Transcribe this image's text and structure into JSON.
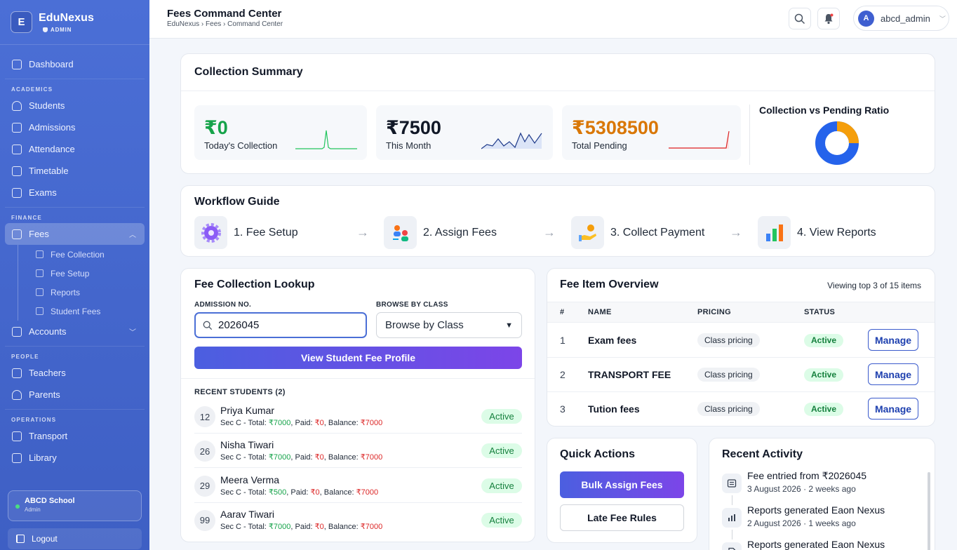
{
  "brand": {
    "logo_letter": "E",
    "name": "EduNexus",
    "badge": "ADMIN"
  },
  "sidebar": {
    "dashboard": "Dashboard",
    "sections": {
      "academics": "ACADEMICS",
      "finance": "FINANCE",
      "people": "PEOPLE",
      "operations": "OPERATIONS"
    },
    "academics": [
      "Students",
      "Admissions",
      "Attendance",
      "Timetable",
      "Exams"
    ],
    "fees": "Fees",
    "fees_sub": [
      "Fee Collection",
      "Fee Setup",
      "Reports",
      "Student Fees"
    ],
    "accounts": "Accounts",
    "people": [
      "Teachers",
      "Parents"
    ],
    "operations": [
      "Transport",
      "Library"
    ],
    "school": {
      "name": "ABCD School",
      "role": "Admin"
    },
    "logout": "Logout"
  },
  "header": {
    "title": "Fees Command Center",
    "breadcrumb": [
      "EduNexus",
      "Fees",
      "Command Center"
    ],
    "user": {
      "initial": "A",
      "name": "abcd_admin"
    }
  },
  "summary": {
    "title": "Collection Summary",
    "stats": [
      {
        "value": "₹0",
        "label": "Today's Collection",
        "color": "#16a34a"
      },
      {
        "value": "₹7500",
        "label": "This Month",
        "color": "#111827"
      },
      {
        "value": "₹5308500",
        "label": "Total Pending",
        "color": "#d97706"
      }
    ],
    "ratio_title": "Collection vs Pending Ratio",
    "ratio": {
      "collected_color": "#f59e0b",
      "pending_color": "#2563eb",
      "collected_fraction": 0.25
    }
  },
  "workflow": {
    "title": "Workflow Guide",
    "steps": [
      "1. Fee Setup",
      "2. Assign Fees",
      "3. Collect Payment",
      "4. View Reports"
    ]
  },
  "lookup": {
    "title": "Fee Collection Lookup",
    "admission_label": "ADMISSION NO.",
    "admission_value": "2026045",
    "browse_label": "BROWSE BY CLASS",
    "browse_value": "Browse by Class",
    "button": "View Student Fee Profile",
    "recent_label": "RECENT STUDENTS (2)",
    "students": [
      {
        "roll": "12",
        "name": "Priya Kumar",
        "prefix": "Sec C - Total: ",
        "total": "₹7000",
        "paid": "₹0",
        "balance": "₹7000",
        "status": "Active"
      },
      {
        "roll": "26",
        "name": "Nisha Tiwari",
        "prefix": "Sec C - Total: ",
        "total": "₹7000",
        "paid": "₹0",
        "balance": "₹7000",
        "status": "Active"
      },
      {
        "roll": "29",
        "name": "Meera Verma",
        "prefix": "Sec C - Total: ",
        "total": "₹500",
        "paid": "₹0",
        "balance": "₹7000",
        "status": "Active"
      },
      {
        "roll": "99",
        "name": "Aarav Tiwari",
        "prefix": "Sec C - Total: ",
        "total": "₹7000",
        "paid": "₹0",
        "balance": "₹7000",
        "status": "Active"
      }
    ],
    "paid_prefix": ", Paid: ",
    "balance_prefix": ", Balance: "
  },
  "fee_items": {
    "title": "Fee Item Overview",
    "viewing": "Viewing top 3 of 15 items",
    "columns": [
      "#",
      "NAME",
      "PRICING",
      "STATUS"
    ],
    "rows": [
      {
        "num": "1",
        "name": "Exam fees",
        "pricing": "Class pricing",
        "status": "Active",
        "action": "Manage"
      },
      {
        "num": "2",
        "name": "TRANSPORT FEE",
        "pricing": "Class pricing",
        "status": "Active",
        "action": "Manage"
      },
      {
        "num": "3",
        "name": "Tution fees",
        "pricing": "Class pricing",
        "status": "Active",
        "action": "Manage"
      }
    ]
  },
  "quick_actions": {
    "title": "Quick Actions",
    "primary": "Bulk Assign Fees",
    "secondary": "Late Fee Rules"
  },
  "recent_activity": {
    "title": "Recent Activity",
    "items": [
      {
        "text": "Fee entried from ₹2026045",
        "date": "3 August 2026",
        "ago": "2 weeks ago",
        "icon": "receipt-icon"
      },
      {
        "text": "Reports generated Eaon Nexus",
        "date": "2 August 2026",
        "ago": "1 weeks ago",
        "icon": "chart-icon"
      },
      {
        "text": "Reports generated Eaon Nexus",
        "date": "",
        "ago": "",
        "icon": "document-icon"
      }
    ]
  }
}
